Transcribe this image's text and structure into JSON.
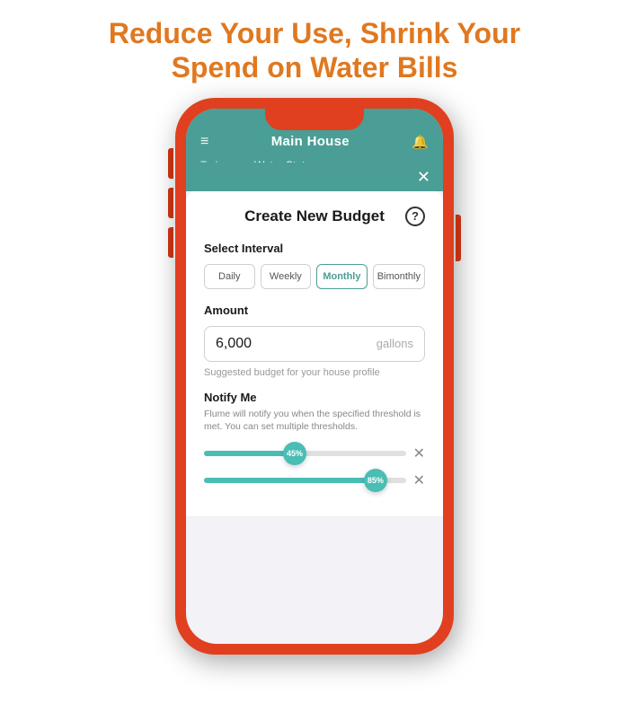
{
  "headline": {
    "line1": "Reduce Your Use, Shrink Your",
    "line2": "Spend on Water Bills"
  },
  "app": {
    "title": "Main House",
    "tabs": [
      {
        "label": "Today",
        "active": false
      },
      {
        "label": "Water Status",
        "active": true
      }
    ],
    "close_button": "✕"
  },
  "modal": {
    "title": "Create New Budget",
    "help_label": "?",
    "interval_label": "Select Interval",
    "intervals": [
      {
        "label": "Daily",
        "active": false
      },
      {
        "label": "Weekly",
        "active": false
      },
      {
        "label": "Monthly",
        "active": true
      },
      {
        "label": "Bimonthly",
        "active": false
      }
    ],
    "amount_label": "Amount",
    "amount_value": "6,000",
    "amount_unit": "gallons",
    "suggested_text": "Suggested budget for your house profile",
    "notify_title": "Notify Me",
    "notify_desc": "Flume will notify you when the specified threshold is met. You can set multiple thresholds.",
    "sliders": [
      {
        "value": 45,
        "label": "45%"
      },
      {
        "value": 85,
        "label": "85%"
      }
    ]
  },
  "icons": {
    "hamburger": "≡",
    "bell": "🔔",
    "close": "✕"
  }
}
